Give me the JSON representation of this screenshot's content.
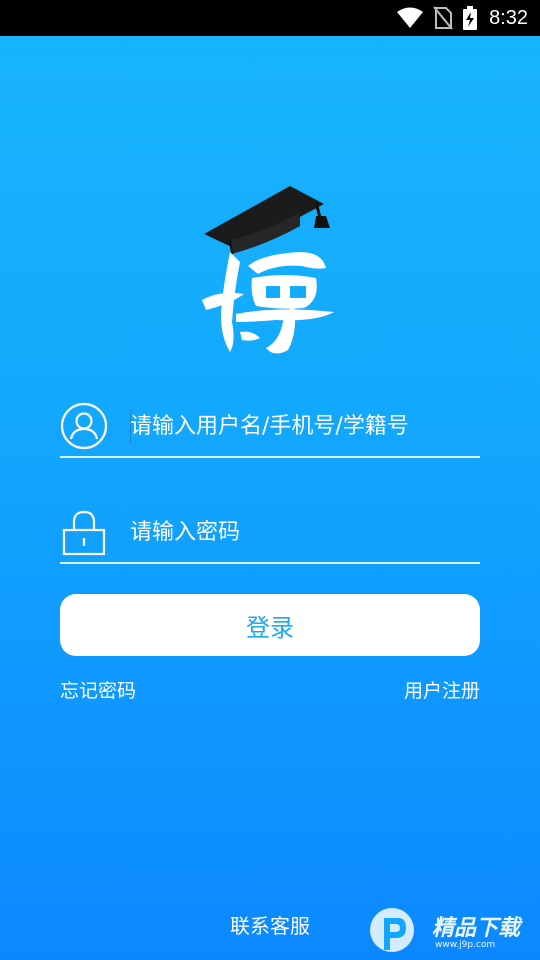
{
  "status_bar": {
    "time": "8:32",
    "icons": [
      "wifi-icon",
      "no-sim-icon",
      "battery-charging-icon"
    ]
  },
  "logo": {
    "icon": "graduation-cap-bo-logo",
    "text": "博"
  },
  "login_form": {
    "username_placeholder": "请输入用户名/手机号/学籍号",
    "username_value": "",
    "password_placeholder": "请输入密码",
    "password_value": "",
    "username_icon": "user-icon",
    "password_icon": "lock-icon",
    "submit_label": "登录"
  },
  "links": {
    "forgot_password": "忘记密码",
    "register": "用户注册",
    "contact_support": "联系客服"
  },
  "watermark": {
    "brand": "精品下载",
    "url": "www.j9p.com"
  },
  "colors": {
    "background_top": "#19b6fb",
    "background_bottom": "#0c88ff",
    "button_bg": "#ffffff",
    "button_text": "#19aaf5"
  }
}
